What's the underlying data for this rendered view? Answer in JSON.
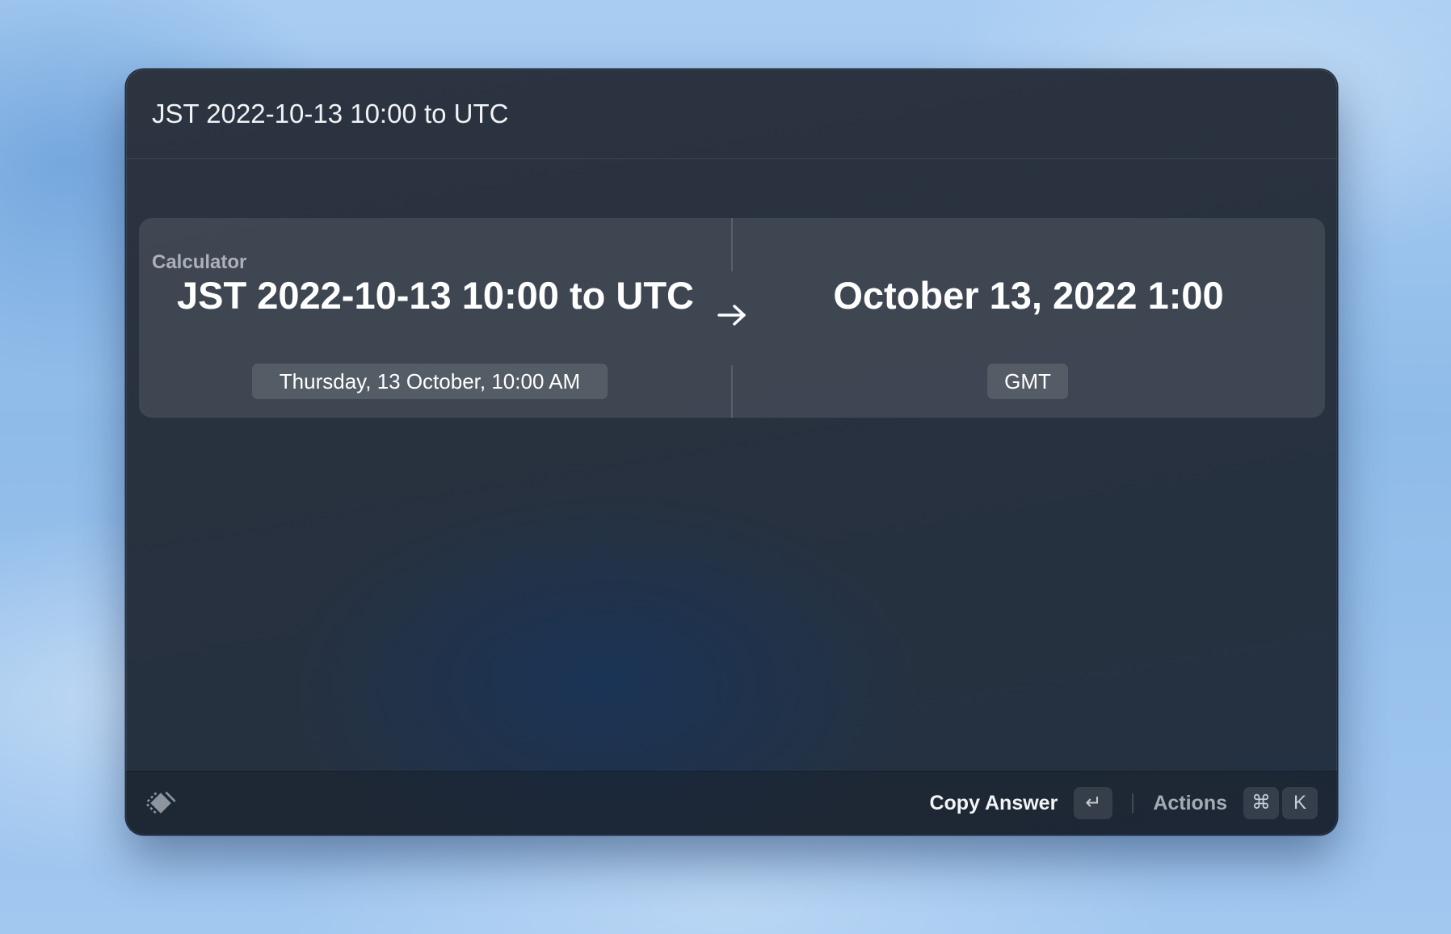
{
  "search": {
    "query": "JST 2022-10-13 10:00 to UTC"
  },
  "section": {
    "title": "Calculator"
  },
  "calculator": {
    "input": {
      "main": "JST 2022-10-13 10:00 to UTC",
      "sub": "Thursday, 13 October, 10:00 AM"
    },
    "arrow_icon": "right-arrow-icon",
    "output": {
      "main": "October 13, 2022 1:00",
      "sub": "GMT"
    }
  },
  "footer": {
    "logo_icon": "raycast-logo-icon",
    "primary_action": {
      "label": "Copy Answer",
      "shortcut": "↵"
    },
    "secondary_action": {
      "label": "Actions",
      "shortcut_modifier": "⌘",
      "shortcut_key": "K"
    }
  },
  "colors": {
    "window_bg": "#28313e",
    "text_primary": "#ffffff",
    "text_secondary": "#a3a9b2",
    "desktop_bg": "#a9cdf2"
  }
}
